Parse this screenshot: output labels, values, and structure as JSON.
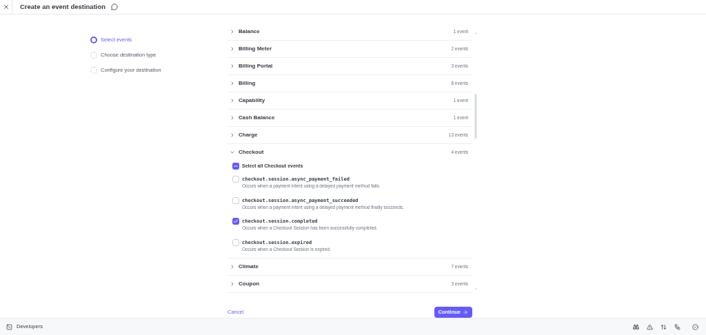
{
  "header": {
    "title": "Create an event destination"
  },
  "steps": [
    {
      "label": "Select events",
      "selected": true
    },
    {
      "label": "Choose destination type",
      "selected": false
    },
    {
      "label": "Configure your destination",
      "selected": false
    }
  ],
  "categories": [
    {
      "name": "Balance",
      "count": "1 event",
      "expanded": false
    },
    {
      "name": "Billing Meter",
      "count": "2 events",
      "expanded": false
    },
    {
      "name": "Billing Portal",
      "count": "3 events",
      "expanded": false
    },
    {
      "name": "Billing",
      "count": "8 events",
      "expanded": false
    },
    {
      "name": "Capability",
      "count": "1 event",
      "expanded": false
    },
    {
      "name": "Cash Balance",
      "count": "1 event",
      "expanded": false
    },
    {
      "name": "Charge",
      "count": "13 events",
      "expanded": false
    },
    {
      "name": "Checkout",
      "count": "4 events",
      "expanded": true,
      "select_all": {
        "label": "Select all Checkout events",
        "indeterminate": true
      },
      "events": [
        {
          "name": "checkout.session.async_payment_failed",
          "description": "Occurs when a payment intent using a delayed payment method fails.",
          "checked": false
        },
        {
          "name": "checkout.session.async_payment_succeeded",
          "description": "Occurs when a payment intent using a delayed payment method finally succeeds.",
          "checked": false
        },
        {
          "name": "checkout.session.completed",
          "description": "Occurs when a Checkout Session has been successfully completed.",
          "checked": true
        },
        {
          "name": "checkout.session.expired",
          "description": "Occurs when a Checkout Session is expired.",
          "checked": false
        }
      ]
    },
    {
      "name": "Climate",
      "count": "7 events",
      "expanded": false
    },
    {
      "name": "Coupon",
      "count": "3 events",
      "expanded": false
    }
  ],
  "actions": {
    "cancel": "Cancel",
    "continue": "Continue"
  },
  "bottom_bar": {
    "label": "Developers"
  }
}
